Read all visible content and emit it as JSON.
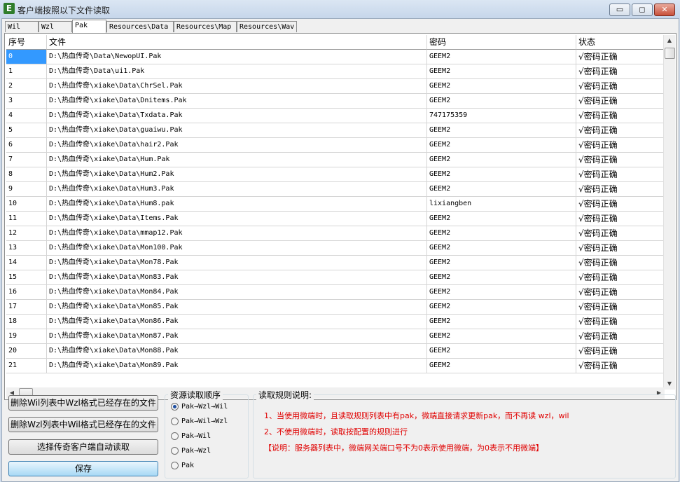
{
  "window": {
    "title": "客户端按照以下文件读取",
    "icon_letter": "E"
  },
  "tabs": [
    "Wil",
    "Wzl",
    "Pak",
    "Resources\\Data",
    "Resources\\Map",
    "Resources\\Wav"
  ],
  "active_tab": "Pak",
  "table": {
    "columns": [
      "序号",
      "文件",
      "密码",
      "状态"
    ],
    "rows": [
      [
        "0",
        "D:\\热血传奇\\Data\\NewopUI.Pak",
        "GEEM2",
        "√密码正确"
      ],
      [
        "1",
        "D:\\热血传奇\\Data\\ui1.Pak",
        "GEEM2",
        "√密码正确"
      ],
      [
        "2",
        "D:\\热血传奇\\xiake\\Data\\ChrSel.Pak",
        "GEEM2",
        "√密码正确"
      ],
      [
        "3",
        "D:\\热血传奇\\xiake\\Data\\Dnitems.Pak",
        "GEEM2",
        "√密码正确"
      ],
      [
        "4",
        "D:\\热血传奇\\xiake\\Data\\Txdata.Pak",
        "747175359",
        "√密码正确"
      ],
      [
        "5",
        "D:\\热血传奇\\xiake\\Data\\guaiwu.Pak",
        "GEEM2",
        "√密码正确"
      ],
      [
        "6",
        "D:\\热血传奇\\xiake\\Data\\hair2.Pak",
        "GEEM2",
        "√密码正确"
      ],
      [
        "7",
        "D:\\热血传奇\\xiake\\Data\\Hum.Pak",
        "GEEM2",
        "√密码正确"
      ],
      [
        "8",
        "D:\\热血传奇\\xiake\\Data\\Hum2.Pak",
        "GEEM2",
        "√密码正确"
      ],
      [
        "9",
        "D:\\热血传奇\\xiake\\Data\\Hum3.Pak",
        "GEEM2",
        "√密码正确"
      ],
      [
        "10",
        "D:\\热血传奇\\xiake\\Data\\Hum8.pak",
        "lixiangben",
        "√密码正确"
      ],
      [
        "11",
        "D:\\热血传奇\\xiake\\Data\\Items.Pak",
        "GEEM2",
        "√密码正确"
      ],
      [
        "12",
        "D:\\热血传奇\\xiake\\Data\\mmap12.Pak",
        "GEEM2",
        "√密码正确"
      ],
      [
        "13",
        "D:\\热血传奇\\xiake\\Data\\Mon100.Pak",
        "GEEM2",
        "√密码正确"
      ],
      [
        "14",
        "D:\\热血传奇\\xiake\\Data\\Mon78.Pak",
        "GEEM2",
        "√密码正确"
      ],
      [
        "15",
        "D:\\热血传奇\\xiake\\Data\\Mon83.Pak",
        "GEEM2",
        "√密码正确"
      ],
      [
        "16",
        "D:\\热血传奇\\xiake\\Data\\Mon84.Pak",
        "GEEM2",
        "√密码正确"
      ],
      [
        "17",
        "D:\\热血传奇\\xiake\\Data\\Mon85.Pak",
        "GEEM2",
        "√密码正确"
      ],
      [
        "18",
        "D:\\热血传奇\\xiake\\Data\\Mon86.Pak",
        "GEEM2",
        "√密码正确"
      ],
      [
        "19",
        "D:\\热血传奇\\xiake\\Data\\Mon87.Pak",
        "GEEM2",
        "√密码正确"
      ],
      [
        "20",
        "D:\\热血传奇\\xiake\\Data\\Mon88.Pak",
        "GEEM2",
        "√密码正确"
      ],
      [
        "21",
        "D:\\热血传奇\\xiake\\Data\\Mon89.Pak",
        "GEEM2",
        "√密码正确"
      ]
    ],
    "selected_row": 0
  },
  "buttons": {
    "delete_wil": "删除Wil列表中Wzl格式已经存在的文件",
    "delete_wzl": "删除Wzl列表中Wil格式已经存在的文件",
    "auto_read": "选择传奇客户端自动读取",
    "save": "保存"
  },
  "order_group": {
    "title": "资源读取顺序",
    "options": [
      "Pak→Wzl→Wil",
      "Pak→Wil→Wzl",
      "Pak→Wil",
      "Pak→Wzl",
      "Pak"
    ],
    "selected": 0
  },
  "rules": {
    "title": "读取规则说明:",
    "lines": [
      "1、当使用微端时，且读取规则列表中有pak，微端直接请求更新pak，而不再读 wzl，wil",
      "2、不使用微端时，读取按配置的规则进行",
      "【说明：服务器列表中，微端网关端口号不为0表示使用微端，为0表示不用微端】"
    ]
  },
  "colors": {
    "selection": "#3399ff",
    "note_text": "#e00000"
  }
}
